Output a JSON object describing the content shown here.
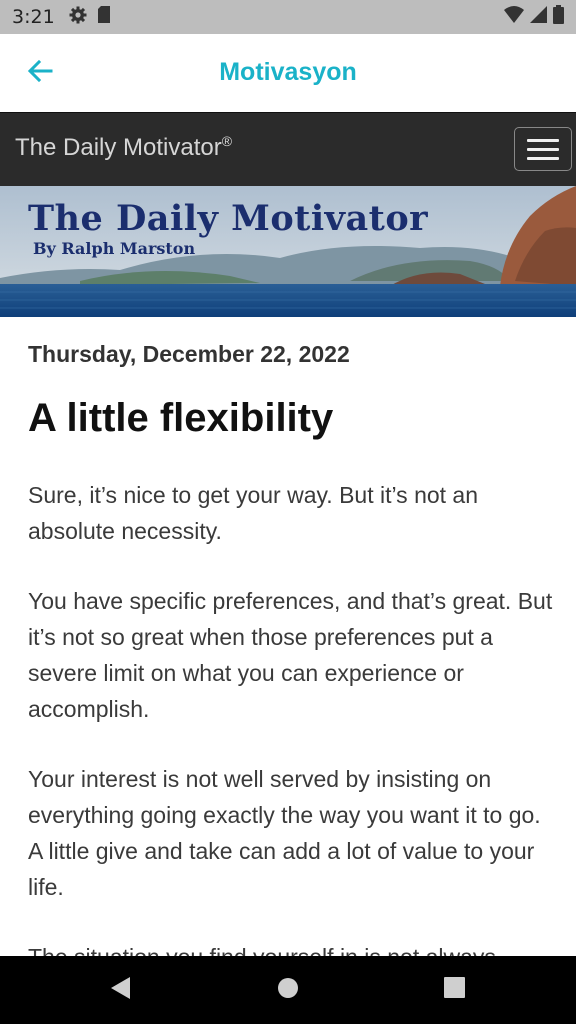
{
  "status_bar": {
    "time": "3:21",
    "icons_left": [
      "gear-icon",
      "sd-card-icon"
    ],
    "icons_right": [
      "wifi-icon",
      "signal-icon",
      "battery-icon"
    ]
  },
  "app_bar": {
    "title": "Motivasyon",
    "back_icon": "arrow-left-icon",
    "accent_color": "#1ab2c8"
  },
  "site_header": {
    "name": "The Daily Motivator",
    "registered_mark": "®",
    "menu_icon": "hamburger-icon"
  },
  "banner": {
    "title": "The Daily Motivator",
    "subtitle": "By Ralph Marston",
    "title_color": "#1b2e6e"
  },
  "article": {
    "date": "Thursday, December 22, 2022",
    "title": "A little flexibility",
    "paragraphs": [
      "Sure, it’s nice to get your way. But it’s not an absolute necessity.",
      "You have specific preferences, and that’s great. But it’s not so great when those preferences put a severe limit on what you can experience or accomplish.",
      "Your interest is not well served by insisting on everything going exactly the way you want it to go. A little give and take can add a lot of value to your life.",
      "The situation you find yourself in is not always"
    ]
  },
  "nav_bar": {
    "icons": [
      "back-triangle-icon",
      "home-circle-icon",
      "recents-square-icon"
    ]
  }
}
